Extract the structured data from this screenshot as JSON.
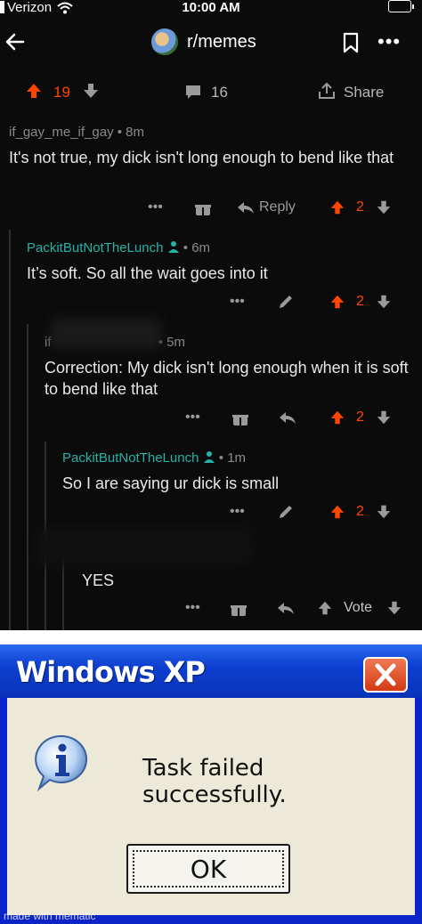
{
  "status_bar": {
    "carrier": "Verizon",
    "time": "10:00 AM"
  },
  "header": {
    "subreddit": "r/memes"
  },
  "post_actions": {
    "score": "19",
    "comments": "16",
    "share_label": "Share"
  },
  "comments": [
    {
      "author": "if_gay_me_if_gay",
      "age": "8m",
      "text": "It's not true, my dick isn't long enough to bend like that",
      "reply_label": "Reply",
      "score": "2"
    },
    {
      "author": "PackitButNotTheLunch",
      "age": "6m",
      "text": "It’s soft. So all the wait goes into it",
      "score": "2"
    },
    {
      "author_visible": "if",
      "age": "5m",
      "text": "Correction: My dick isn't long enough when it is soft to bend like that",
      "score": "2"
    },
    {
      "author": "PackitButNotTheLunch",
      "age": "1m",
      "text": "So I are saying ur dick is small",
      "score": "2"
    },
    {
      "text": "YES",
      "vote_label": "Vote"
    }
  ],
  "dialog": {
    "title": "Windows XP",
    "message": "Task failed successfully.",
    "ok_label": "OK"
  },
  "watermark": "made with mematic",
  "colors": {
    "upvote": "#ff4500",
    "teal": "#24b3a6",
    "xp_blue": "#0a33b8",
    "xp_body": "#ece9d8"
  }
}
